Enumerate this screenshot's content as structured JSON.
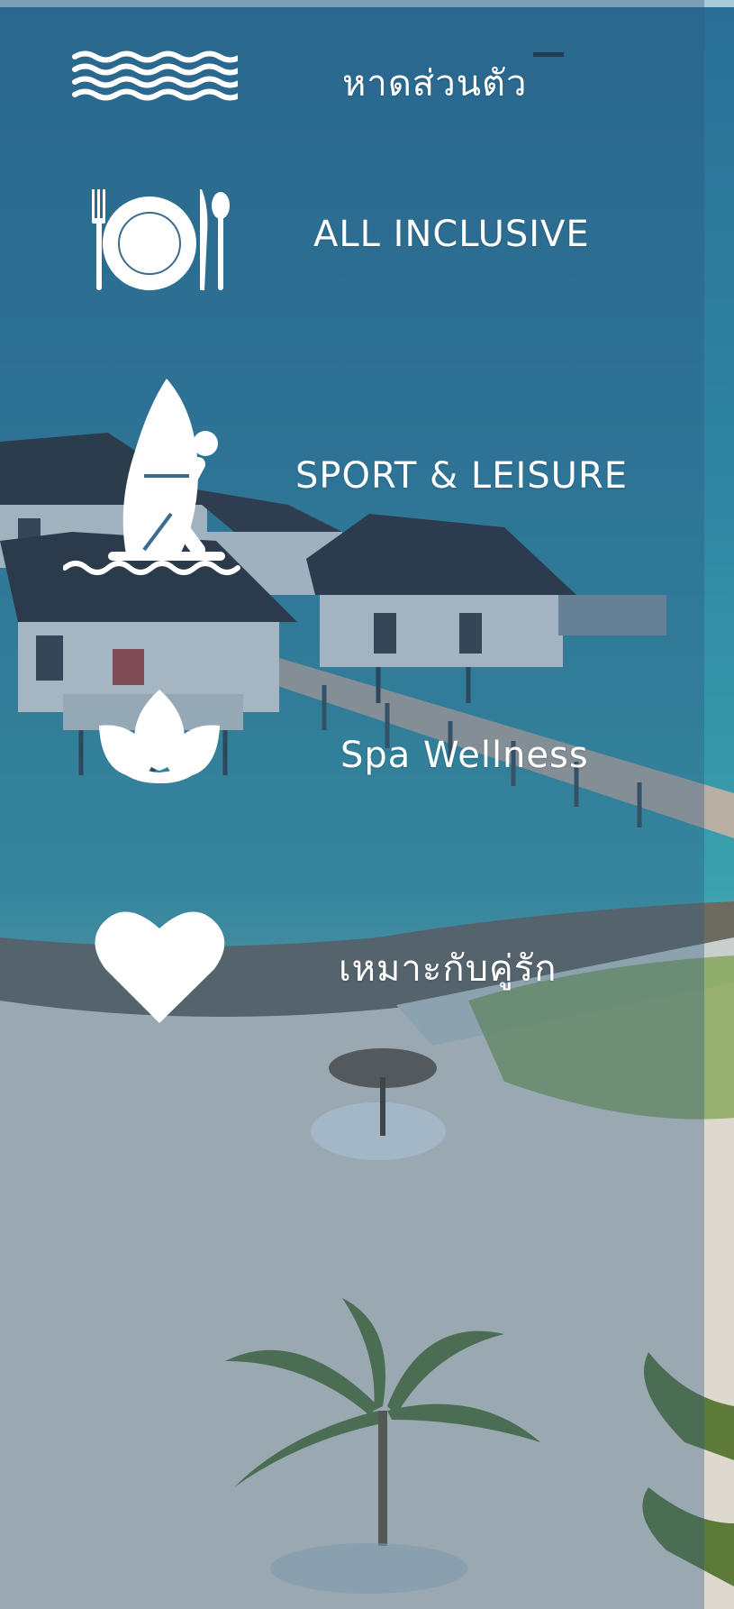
{
  "features": [
    {
      "label": "หาดส่วนตัว",
      "icon": "waves-icon"
    },
    {
      "label": "ALL INCLUSIVE",
      "icon": "plate-cutlery-icon"
    },
    {
      "label": "SPORT & LEISURE",
      "icon": "windsurfer-icon"
    },
    {
      "label": "Spa Wellness",
      "icon": "lotus-icon"
    },
    {
      "label": "เหมาะกับคู่รัก",
      "icon": "heart-icon"
    }
  ],
  "colors": {
    "sea_deep": "#1f5f86",
    "sea_shallow": "#5fb3c2",
    "sand": "#e4e0d6",
    "overlay": "#2d5a82",
    "text": "#ffffff"
  }
}
